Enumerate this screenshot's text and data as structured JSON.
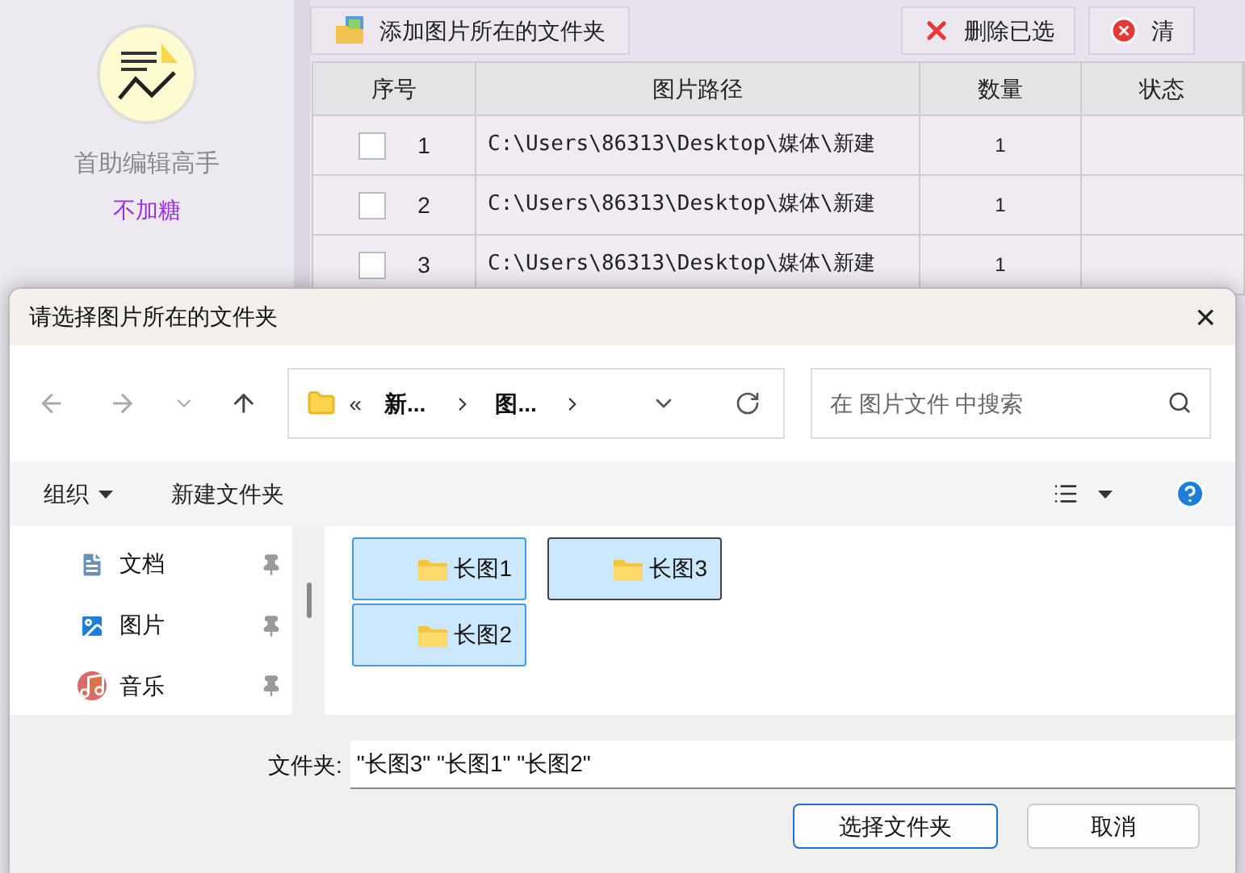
{
  "app": {
    "brand_name": "首助编辑高手",
    "brand_tagline": "不加糖",
    "toolbar": [
      {
        "kind": "add",
        "label": "添加图片所在的文件夹"
      },
      {
        "kind": "delete",
        "label": "删除已选"
      },
      {
        "kind": "clear",
        "label": "清"
      }
    ],
    "table": {
      "columns": [
        "序号",
        "图片路径",
        "数量",
        "状态"
      ],
      "rows": [
        {
          "checked": false,
          "index": "1",
          "path": "C:\\Users\\86313\\Desktop\\媒体\\新建",
          "count": "1"
        },
        {
          "checked": false,
          "index": "2",
          "path": "C:\\Users\\86313\\Desktop\\媒体\\新建",
          "count": "1"
        },
        {
          "checked": false,
          "index": "3",
          "path": "C:\\Users\\86313\\Desktop\\媒体\\新建",
          "count": "1"
        }
      ]
    }
  },
  "dialog": {
    "title": "请选择图片所在的文件夹",
    "close": "×",
    "breadcrumb": [
      "新...",
      "图..."
    ],
    "breadcrumb_prefix": "«",
    "search": {
      "placeholder": "在 图片文件 中搜索"
    },
    "toolbar": {
      "organize": "组织",
      "new_folder": "新建文件夹"
    },
    "nav": [
      {
        "kind": "document",
        "label": "文档"
      },
      {
        "kind": "picture",
        "label": "图片"
      },
      {
        "kind": "music",
        "label": "音乐"
      }
    ],
    "items": [
      {
        "label": "长图1",
        "selected": true,
        "focused": false
      },
      {
        "label": "长图3",
        "selected": true,
        "focused": true
      },
      {
        "label": "长图2",
        "selected": true,
        "focused": false
      }
    ],
    "folder_label": "文件夹:",
    "folder_value": "\"长图3\" \"长图1\" \"长图2\"",
    "buttons": [
      {
        "label": "选择文件夹",
        "primary": true
      },
      {
        "label": "取消",
        "primary": false
      }
    ]
  }
}
